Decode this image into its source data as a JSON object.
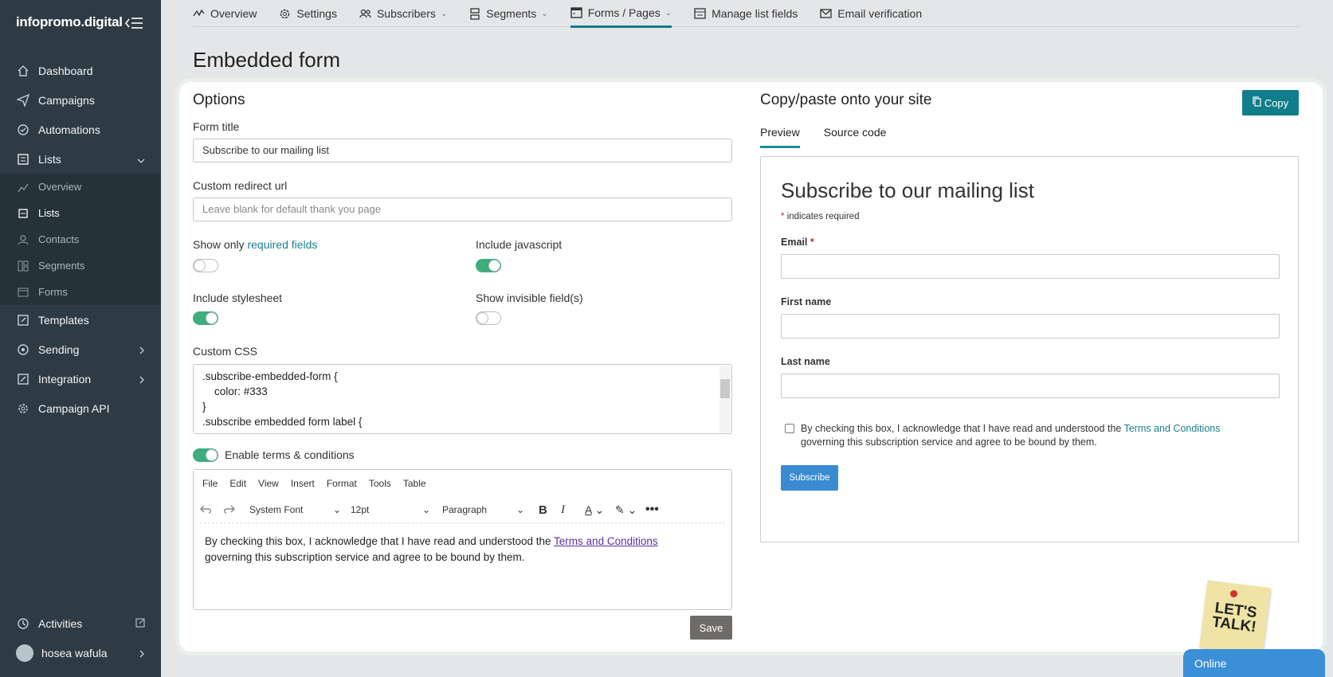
{
  "brand": {
    "logo_text": "infopromo.digital",
    "accent": "#117d8a",
    "sidebar_bg": "#2f3b44"
  },
  "sidebar": {
    "items": [
      {
        "label": "Dashboard",
        "icon": "home-icon"
      },
      {
        "label": "Campaigns",
        "icon": "send-icon"
      },
      {
        "label": "Automations",
        "icon": "automation-icon"
      },
      {
        "label": "Lists",
        "icon": "list-icon",
        "expanded": true
      }
    ],
    "sub_items": [
      {
        "label": "Overview",
        "icon": "chart-icon"
      },
      {
        "label": "Lists",
        "icon": "list-icon",
        "active": true
      },
      {
        "label": "Contacts",
        "icon": "user-icon"
      },
      {
        "label": "Segments",
        "icon": "segments-icon"
      },
      {
        "label": "Forms",
        "icon": "form-icon"
      }
    ],
    "items_after": [
      {
        "label": "Templates",
        "icon": "template-icon"
      },
      {
        "label": "Sending",
        "icon": "sending-icon"
      },
      {
        "label": "Integration",
        "icon": "integration-icon"
      },
      {
        "label": "Campaign API",
        "icon": "gear-icon"
      }
    ],
    "bottom": {
      "activities": "Activities",
      "user": "hosea wafula"
    }
  },
  "topnav": {
    "tabs": [
      {
        "label": "Overview",
        "dropdown": false
      },
      {
        "label": "Settings",
        "dropdown": false
      },
      {
        "label": "Subscribers",
        "dropdown": true
      },
      {
        "label": "Segments",
        "dropdown": true
      },
      {
        "label": "Forms / Pages",
        "dropdown": true,
        "active": true
      },
      {
        "label": "Manage list fields",
        "dropdown": false
      },
      {
        "label": "Email verification",
        "dropdown": false
      }
    ]
  },
  "page": {
    "title": "Embedded form"
  },
  "options": {
    "title": "Options",
    "form_title_label": "Form title",
    "form_title_value": "Subscribe to our mailing list",
    "redirect_label": "Custom redirect url",
    "redirect_placeholder": "Leave blank for default thank you page",
    "show_required_prefix": "Show only ",
    "show_required_link": "required fields",
    "show_required_on": false,
    "include_js_label": "Include javascript",
    "include_js_on": true,
    "include_css_label": "Include stylesheet",
    "include_css_on": true,
    "show_invisible_label": "Show invisible field(s)",
    "show_invisible_on": false,
    "custom_css_label": "Custom CSS",
    "custom_css_lines": [
      ".subscribe-embedded-form {",
      "    color: #333",
      "}",
      ".subscribe  embedded  form label {"
    ],
    "terms_toggle_label": "Enable terms & conditions",
    "terms_toggle_on": true,
    "editor": {
      "menu": [
        "File",
        "Edit",
        "View",
        "Insert",
        "Format",
        "Tools",
        "Table"
      ],
      "font": "System Font",
      "size": "12pt",
      "block": "Paragraph",
      "body_prefix": "By checking this box, I acknowledge that I have read and understood the ",
      "body_link": "Terms and Conditions",
      "body_suffix": "governing this subscription service and agree to be bound by them."
    },
    "save_label": "Save"
  },
  "copy_panel": {
    "title": "Copy/paste onto your site",
    "copy_label": "Copy",
    "tabs": [
      "Preview",
      "Source code"
    ],
    "preview": {
      "title": "Subscribe to our mailing list",
      "required_note": "indicates required",
      "email_label": "Email",
      "first_name_label": "First name",
      "last_name_label": "Last name",
      "terms_prefix": "By checking this box, I acknowledge that I have read and understood the ",
      "terms_link": "Terms and Conditions",
      "terms_suffix": "governing this subscription service and agree to be bound by them.",
      "subscribe_label": "Subscribe"
    }
  },
  "chat": {
    "sticker_text": "LET'S TALK!",
    "status": "Online"
  }
}
